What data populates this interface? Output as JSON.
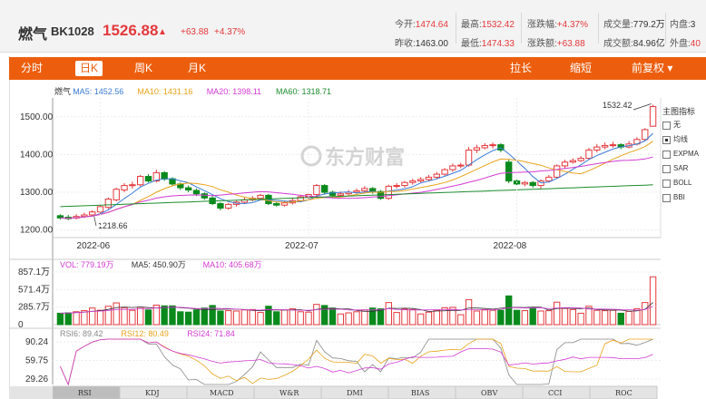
{
  "header": {
    "name": "燃气",
    "code": "BK1028",
    "price": "1526.88",
    "arrow": "▲",
    "change": "+63.88",
    "change_pct": "+4.37%"
  },
  "stats": [
    {
      "k": "今开:",
      "v": "1474.64",
      "cls": "v"
    },
    {
      "k": "最高:",
      "v": "1532.42",
      "cls": "v"
    },
    {
      "k": "涨跌幅:",
      "v": "+4.37%",
      "cls": "v"
    },
    {
      "k": "成交量:",
      "v": "779.2万",
      "cls": "v n"
    },
    {
      "k": "内盘:",
      "v": "3",
      "cls": "v n"
    },
    {
      "k": "昨收:",
      "v": "1463.00",
      "cls": "v n"
    },
    {
      "k": "最低:",
      "v": "1474.33",
      "cls": "v"
    },
    {
      "k": "涨跌额:",
      "v": "+63.88",
      "cls": "v"
    },
    {
      "k": "成交额:",
      "v": "84.96亿",
      "cls": "v n"
    },
    {
      "k": "外盘:",
      "v": "40",
      "cls": "v"
    }
  ],
  "tabs": {
    "left": [
      "分时",
      "日K",
      "周K",
      "月K"
    ],
    "active": "日K",
    "right": [
      "拉长",
      "缩短",
      "前复权 ▾"
    ]
  },
  "ma_legend": [
    {
      "label": "燃气",
      "color": "#333333"
    },
    {
      "label": "MA5: 1452.56",
      "color": "#3a7bd5"
    },
    {
      "label": "MA10: 1431.16",
      "color": "#e8a21a"
    },
    {
      "label": "MA20: 1398.11",
      "color": "#d33ad3"
    },
    {
      "label": "MA60: 1318.71",
      "color": "#1c8c2d"
    }
  ],
  "vol_legend": [
    {
      "label": "VOL: 779.19万",
      "color": "#d33ad3"
    },
    {
      "label": "MA5: 450.90万",
      "color": "#333333"
    },
    {
      "label": "MA10: 405.68万",
      "color": "#d33ad3"
    }
  ],
  "rsi_legend": [
    {
      "label": "RSI6: 89.42",
      "color": "#888888"
    },
    {
      "label": "RSI12: 80.49",
      "color": "#e8a21a"
    },
    {
      "label": "RSI24: 71.84",
      "color": "#d33ad3"
    }
  ],
  "watermark": "东方财富",
  "side_panel": {
    "title": "主图指标",
    "options": [
      {
        "label": "无",
        "checked": false
      },
      {
        "label": "均线",
        "checked": true
      },
      {
        "label": "EXPMA",
        "checked": false
      },
      {
        "label": "SAR",
        "checked": false
      },
      {
        "label": "BOLL",
        "checked": false
      },
      {
        "label": "BBI",
        "checked": false
      }
    ]
  },
  "bottom_tabs": [
    "RSI",
    "KDJ",
    "MACD",
    "W&R",
    "DMI",
    "BIAS",
    "OBV",
    "CCI",
    "ROC"
  ],
  "bottom_active": "RSI",
  "colors": {
    "up": "#e4393c",
    "down": "#0a8a1c",
    "accent": "#ec5e0e"
  },
  "chart_data": {
    "type": "candlestick",
    "price_axis": {
      "ticks": [
        "1500.00",
        "1400.00",
        "1300.00",
        "1200.00"
      ],
      "ylim": [
        1180,
        1550
      ]
    },
    "date_labels": [
      "2022-06",
      "2022-07",
      "2022-08"
    ],
    "annotations": {
      "high": "1532.42",
      "low": "1218.66"
    },
    "candles": [
      [
        1238,
        1232,
        1242,
        1228
      ],
      [
        1234,
        1230,
        1240,
        1226
      ],
      [
        1232,
        1236,
        1242,
        1228
      ],
      [
        1236,
        1240,
        1246,
        1232
      ],
      [
        1240,
        1248,
        1252,
        1236
      ],
      [
        1248,
        1262,
        1268,
        1244
      ],
      [
        1260,
        1282,
        1286,
        1256
      ],
      [
        1280,
        1308,
        1312,
        1276
      ],
      [
        1306,
        1318,
        1324,
        1300
      ],
      [
        1318,
        1320,
        1328,
        1310
      ],
      [
        1320,
        1342,
        1346,
        1316
      ],
      [
        1342,
        1330,
        1348,
        1326
      ],
      [
        1330,
        1352,
        1360,
        1326
      ],
      [
        1352,
        1335,
        1356,
        1330
      ],
      [
        1336,
        1322,
        1340,
        1318
      ],
      [
        1322,
        1312,
        1326,
        1306
      ],
      [
        1312,
        1306,
        1318,
        1300
      ],
      [
        1305,
        1296,
        1310,
        1290
      ],
      [
        1296,
        1285,
        1300,
        1280
      ],
      [
        1285,
        1270,
        1290,
        1266
      ],
      [
        1270,
        1258,
        1274,
        1252
      ],
      [
        1258,
        1268,
        1272,
        1254
      ],
      [
        1268,
        1274,
        1278,
        1262
      ],
      [
        1274,
        1280,
        1286,
        1270
      ],
      [
        1280,
        1284,
        1290,
        1276
      ],
      [
        1284,
        1292,
        1296,
        1280
      ],
      [
        1292,
        1270,
        1296,
        1266
      ],
      [
        1270,
        1266,
        1276,
        1262
      ],
      [
        1266,
        1272,
        1278,
        1262
      ],
      [
        1272,
        1278,
        1284,
        1268
      ],
      [
        1278,
        1288,
        1294,
        1274
      ],
      [
        1288,
        1294,
        1300,
        1282
      ],
      [
        1294,
        1318,
        1322,
        1290
      ],
      [
        1318,
        1300,
        1322,
        1294
      ],
      [
        1300,
        1292,
        1304,
        1288
      ],
      [
        1292,
        1296,
        1302,
        1288
      ],
      [
        1296,
        1300,
        1306,
        1290
      ],
      [
        1300,
        1304,
        1310,
        1296
      ],
      [
        1304,
        1310,
        1316,
        1300
      ],
      [
        1310,
        1302,
        1314,
        1296
      ],
      [
        1302,
        1284,
        1306,
        1280
      ],
      [
        1284,
        1316,
        1320,
        1280
      ],
      [
        1316,
        1318,
        1324,
        1310
      ],
      [
        1318,
        1326,
        1330,
        1312
      ],
      [
        1326,
        1330,
        1336,
        1320
      ],
      [
        1330,
        1334,
        1340,
        1326
      ],
      [
        1334,
        1340,
        1346,
        1330
      ],
      [
        1340,
        1348,
        1354,
        1334
      ],
      [
        1348,
        1360,
        1364,
        1344
      ],
      [
        1360,
        1370,
        1376,
        1354
      ],
      [
        1370,
        1372,
        1378,
        1364
      ],
      [
        1372,
        1412,
        1420,
        1368
      ],
      [
        1412,
        1418,
        1426,
        1404
      ],
      [
        1418,
        1424,
        1430,
        1414
      ],
      [
        1424,
        1426,
        1432,
        1416
      ],
      [
        1426,
        1412,
        1430,
        1406
      ],
      [
        1380,
        1330,
        1388,
        1324
      ],
      [
        1330,
        1322,
        1336,
        1316
      ],
      [
        1322,
        1326,
        1330,
        1316
      ],
      [
        1326,
        1318,
        1330,
        1312
      ],
      [
        1318,
        1330,
        1334,
        1310
      ],
      [
        1330,
        1340,
        1346,
        1326
      ],
      [
        1340,
        1370,
        1374,
        1336
      ],
      [
        1370,
        1380,
        1386,
        1364
      ],
      [
        1380,
        1384,
        1390,
        1376
      ],
      [
        1384,
        1390,
        1396,
        1380
      ],
      [
        1390,
        1412,
        1418,
        1386
      ],
      [
        1412,
        1420,
        1428,
        1406
      ],
      [
        1420,
        1424,
        1432,
        1414
      ],
      [
        1424,
        1426,
        1434,
        1418
      ],
      [
        1426,
        1420,
        1430,
        1414
      ],
      [
        1420,
        1428,
        1436,
        1416
      ],
      [
        1428,
        1440,
        1446,
        1424
      ],
      [
        1440,
        1466,
        1470,
        1436
      ],
      [
        1475,
        1527,
        1532,
        1474
      ]
    ],
    "volume_axis": {
      "ticks": [
        "857.1万",
        "571.4万",
        "285.7万",
        "0"
      ],
      "ylim": [
        0,
        857.1
      ]
    },
    "rsi_axis": {
      "ticks": [
        "90.24",
        "59.75",
        "29.26"
      ],
      "ylim": [
        20,
        95
      ]
    }
  }
}
